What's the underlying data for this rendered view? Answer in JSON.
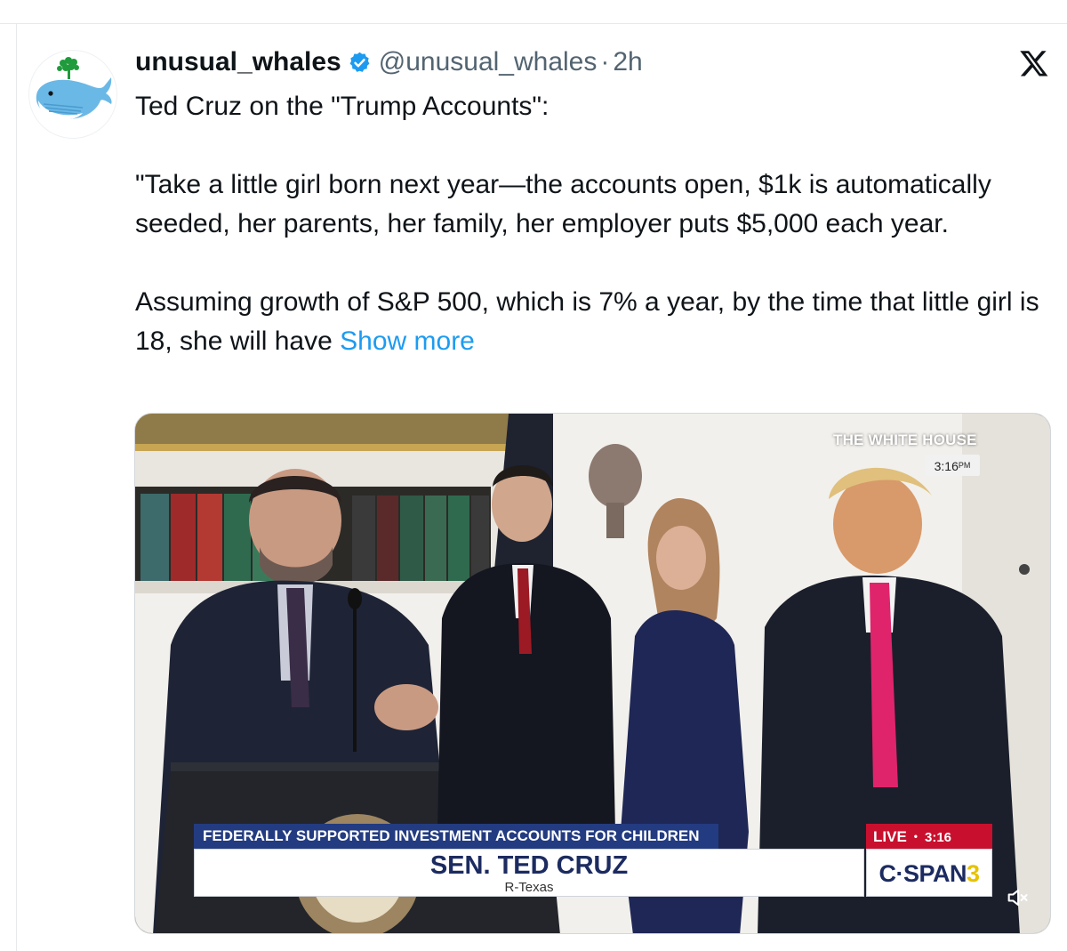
{
  "tweet": {
    "display_name": "unusual_whales",
    "handle": "@unusual_whales",
    "separator": "·",
    "time": "2h",
    "text_line1": "Ted Cruz on the \"Trump Accounts\":",
    "text_para2": "\"Take a little girl born next year—the accounts open, $1k is automatically seeded, her parents, her family, her employer puts $5,000 each year.",
    "text_para3": "Assuming growth of S&P 500, which is 7% a year, by the time that little girl is 18, she will have",
    "show_more": "Show more",
    "icons": {
      "verified": "verified-badge-icon",
      "platform": "x-logo-icon",
      "avatar": "whale-avatar"
    },
    "colors": {
      "link": "#1d9bf0",
      "verified": "#1d9bf0",
      "secondary_text": "#536471"
    }
  },
  "video": {
    "channel_badge": "THE WHITE HOUSE",
    "channel_time": "3:16",
    "channel_time_suffix": "PM",
    "lower_third_topic": "FEDERALLY SUPPORTED INVESTMENT ACCOUNTS FOR CHILDREN",
    "lower_third_name": "SEN. TED CRUZ",
    "lower_third_sub": "R-Texas",
    "live_label": "LIVE",
    "live_dot": "•",
    "live_time": "3:16",
    "network_main": "C·SPAN",
    "network_num": "3",
    "mute_icon": "speaker-muted-icon",
    "colors": {
      "topic_bar": "#233b80",
      "live_bar": "#c8102e",
      "name_text": "#1c2b60"
    }
  }
}
